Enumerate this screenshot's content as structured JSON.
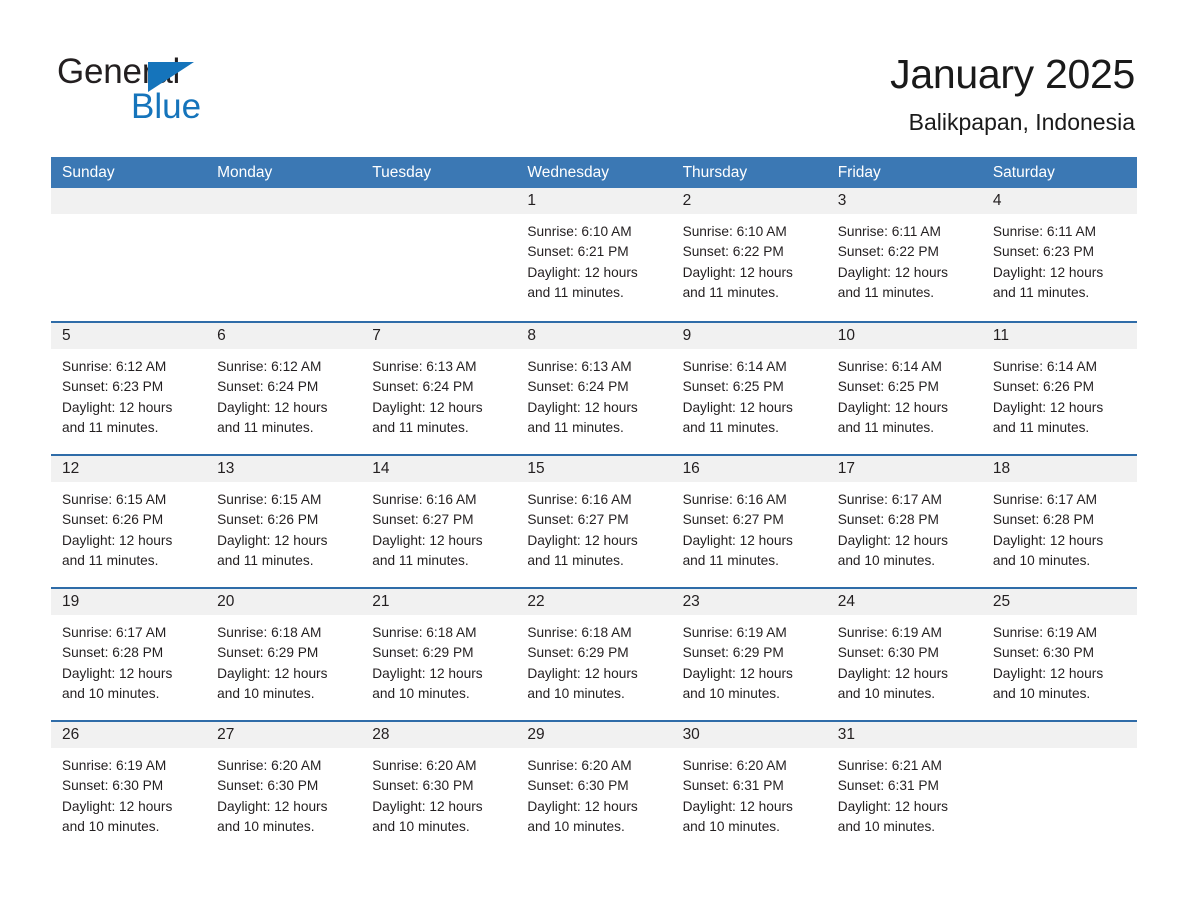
{
  "brand": {
    "name_part1": "General",
    "name_part2": "Blue",
    "accent_color": "#1574bb"
  },
  "header": {
    "month_title": "January 2025",
    "location": "Balikpapan, Indonesia",
    "header_bg_color": "#3b78b4",
    "row_divider_color": "#2f6ca8",
    "daynum_band_color": "#f1f1f1"
  },
  "weekday_headers": [
    "Sunday",
    "Monday",
    "Tuesday",
    "Wednesday",
    "Thursday",
    "Friday",
    "Saturday"
  ],
  "weeks": [
    [
      {
        "empty": true
      },
      {
        "empty": true
      },
      {
        "empty": true
      },
      {
        "day": "1",
        "sunrise": "Sunrise: 6:10 AM",
        "sunset": "Sunset: 6:21 PM",
        "daylight": "Daylight: 12 hours and 11 minutes."
      },
      {
        "day": "2",
        "sunrise": "Sunrise: 6:10 AM",
        "sunset": "Sunset: 6:22 PM",
        "daylight": "Daylight: 12 hours and 11 minutes."
      },
      {
        "day": "3",
        "sunrise": "Sunrise: 6:11 AM",
        "sunset": "Sunset: 6:22 PM",
        "daylight": "Daylight: 12 hours and 11 minutes."
      },
      {
        "day": "4",
        "sunrise": "Sunrise: 6:11 AM",
        "sunset": "Sunset: 6:23 PM",
        "daylight": "Daylight: 12 hours and 11 minutes."
      }
    ],
    [
      {
        "day": "5",
        "sunrise": "Sunrise: 6:12 AM",
        "sunset": "Sunset: 6:23 PM",
        "daylight": "Daylight: 12 hours and 11 minutes."
      },
      {
        "day": "6",
        "sunrise": "Sunrise: 6:12 AM",
        "sunset": "Sunset: 6:24 PM",
        "daylight": "Daylight: 12 hours and 11 minutes."
      },
      {
        "day": "7",
        "sunrise": "Sunrise: 6:13 AM",
        "sunset": "Sunset: 6:24 PM",
        "daylight": "Daylight: 12 hours and 11 minutes."
      },
      {
        "day": "8",
        "sunrise": "Sunrise: 6:13 AM",
        "sunset": "Sunset: 6:24 PM",
        "daylight": "Daylight: 12 hours and 11 minutes."
      },
      {
        "day": "9",
        "sunrise": "Sunrise: 6:14 AM",
        "sunset": "Sunset: 6:25 PM",
        "daylight": "Daylight: 12 hours and 11 minutes."
      },
      {
        "day": "10",
        "sunrise": "Sunrise: 6:14 AM",
        "sunset": "Sunset: 6:25 PM",
        "daylight": "Daylight: 12 hours and 11 minutes."
      },
      {
        "day": "11",
        "sunrise": "Sunrise: 6:14 AM",
        "sunset": "Sunset: 6:26 PM",
        "daylight": "Daylight: 12 hours and 11 minutes."
      }
    ],
    [
      {
        "day": "12",
        "sunrise": "Sunrise: 6:15 AM",
        "sunset": "Sunset: 6:26 PM",
        "daylight": "Daylight: 12 hours and 11 minutes."
      },
      {
        "day": "13",
        "sunrise": "Sunrise: 6:15 AM",
        "sunset": "Sunset: 6:26 PM",
        "daylight": "Daylight: 12 hours and 11 minutes."
      },
      {
        "day": "14",
        "sunrise": "Sunrise: 6:16 AM",
        "sunset": "Sunset: 6:27 PM",
        "daylight": "Daylight: 12 hours and 11 minutes."
      },
      {
        "day": "15",
        "sunrise": "Sunrise: 6:16 AM",
        "sunset": "Sunset: 6:27 PM",
        "daylight": "Daylight: 12 hours and 11 minutes."
      },
      {
        "day": "16",
        "sunrise": "Sunrise: 6:16 AM",
        "sunset": "Sunset: 6:27 PM",
        "daylight": "Daylight: 12 hours and 11 minutes."
      },
      {
        "day": "17",
        "sunrise": "Sunrise: 6:17 AM",
        "sunset": "Sunset: 6:28 PM",
        "daylight": "Daylight: 12 hours and 10 minutes."
      },
      {
        "day": "18",
        "sunrise": "Sunrise: 6:17 AM",
        "sunset": "Sunset: 6:28 PM",
        "daylight": "Daylight: 12 hours and 10 minutes."
      }
    ],
    [
      {
        "day": "19",
        "sunrise": "Sunrise: 6:17 AM",
        "sunset": "Sunset: 6:28 PM",
        "daylight": "Daylight: 12 hours and 10 minutes."
      },
      {
        "day": "20",
        "sunrise": "Sunrise: 6:18 AM",
        "sunset": "Sunset: 6:29 PM",
        "daylight": "Daylight: 12 hours and 10 minutes."
      },
      {
        "day": "21",
        "sunrise": "Sunrise: 6:18 AM",
        "sunset": "Sunset: 6:29 PM",
        "daylight": "Daylight: 12 hours and 10 minutes."
      },
      {
        "day": "22",
        "sunrise": "Sunrise: 6:18 AM",
        "sunset": "Sunset: 6:29 PM",
        "daylight": "Daylight: 12 hours and 10 minutes."
      },
      {
        "day": "23",
        "sunrise": "Sunrise: 6:19 AM",
        "sunset": "Sunset: 6:29 PM",
        "daylight": "Daylight: 12 hours and 10 minutes."
      },
      {
        "day": "24",
        "sunrise": "Sunrise: 6:19 AM",
        "sunset": "Sunset: 6:30 PM",
        "daylight": "Daylight: 12 hours and 10 minutes."
      },
      {
        "day": "25",
        "sunrise": "Sunrise: 6:19 AM",
        "sunset": "Sunset: 6:30 PM",
        "daylight": "Daylight: 12 hours and 10 minutes."
      }
    ],
    [
      {
        "day": "26",
        "sunrise": "Sunrise: 6:19 AM",
        "sunset": "Sunset: 6:30 PM",
        "daylight": "Daylight: 12 hours and 10 minutes."
      },
      {
        "day": "27",
        "sunrise": "Sunrise: 6:20 AM",
        "sunset": "Sunset: 6:30 PM",
        "daylight": "Daylight: 12 hours and 10 minutes."
      },
      {
        "day": "28",
        "sunrise": "Sunrise: 6:20 AM",
        "sunset": "Sunset: 6:30 PM",
        "daylight": "Daylight: 12 hours and 10 minutes."
      },
      {
        "day": "29",
        "sunrise": "Sunrise: 6:20 AM",
        "sunset": "Sunset: 6:30 PM",
        "daylight": "Daylight: 12 hours and 10 minutes."
      },
      {
        "day": "30",
        "sunrise": "Sunrise: 6:20 AM",
        "sunset": "Sunset: 6:31 PM",
        "daylight": "Daylight: 12 hours and 10 minutes."
      },
      {
        "day": "31",
        "sunrise": "Sunrise: 6:21 AM",
        "sunset": "Sunset: 6:31 PM",
        "daylight": "Daylight: 12 hours and 10 minutes."
      },
      {
        "empty": true
      }
    ]
  ]
}
